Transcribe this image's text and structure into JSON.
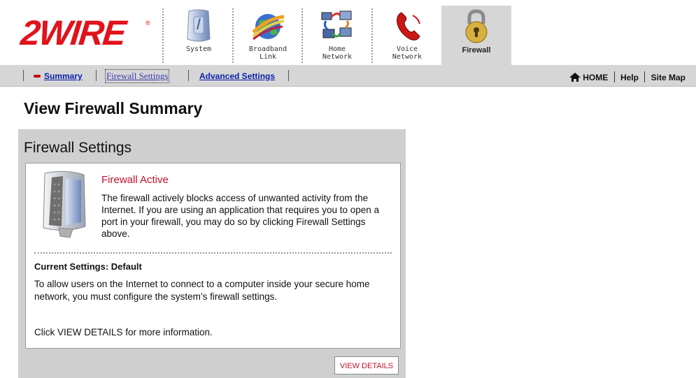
{
  "header": {
    "logo": "2WIRE",
    "tabs": [
      {
        "label": "System",
        "icon": "system-device-icon"
      },
      {
        "label": "Broadband\nLink",
        "icon": "globe-icon"
      },
      {
        "label": "Home\nNetwork",
        "icon": "network-computers-icon"
      },
      {
        "label": "Voice\nNetwork",
        "icon": "telephone-icon"
      },
      {
        "label": "Firewall",
        "icon": "padlock-icon",
        "active": true
      }
    ]
  },
  "subnav": {
    "summary": "Summary",
    "firewall_settings": "Firewall Settings",
    "advanced_settings": "Advanced Settings",
    "home": "HOME",
    "help": "Help",
    "site_map": "Site Map"
  },
  "page": {
    "title": "View Firewall Summary",
    "panel_title": "Firewall Settings",
    "status_title": "Firewall Active",
    "status_text": "The firewall actively blocks access of unwanted activity from the Internet. If you are using an application that requires you to open a port in your firewall, you may do so by clicking Firewall Settings above.",
    "current_settings": "Current Settings: Default",
    "current_text": "To allow users on the Internet to connect to a computer inside your secure home network, you must configure the system’s firewall settings.",
    "more_text": "Click VIEW DETAILS for more information.",
    "view_details": "VIEW DETAILS"
  },
  "colors": {
    "brand_red": "#e0131c",
    "link_blue": "#0a1faa",
    "nav_gray": "#d6d6d6"
  }
}
